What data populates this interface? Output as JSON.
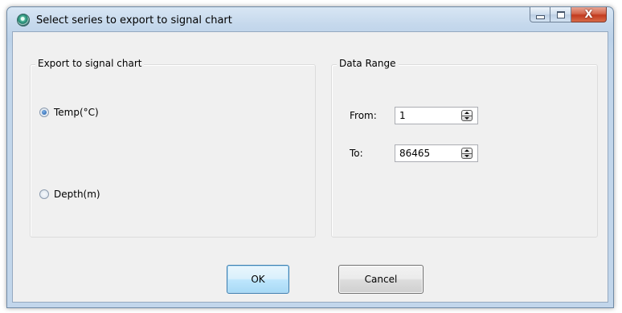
{
  "window": {
    "title": "Select series to export to signal chart",
    "icon": "app-globe-icon",
    "caption_buttons": {
      "minimize_icon": "minimize-icon",
      "maximize_icon": "maximize-icon",
      "close_icon": "close-icon",
      "close_glyph": "X"
    }
  },
  "export_group": {
    "title": "Export to signal chart",
    "options": [
      {
        "label": "Temp(°C)",
        "selected": true
      },
      {
        "label": "Depth(m)",
        "selected": false
      }
    ]
  },
  "range_group": {
    "title": "Data Range",
    "from_label": "From:",
    "from_value": "1",
    "to_label": "To:",
    "to_value": "86465"
  },
  "buttons": {
    "ok_label": "OK",
    "cancel_label": "Cancel"
  },
  "colors": {
    "ok_button_accent": "#3c7fb1",
    "radio_selected": "#1b5aa6",
    "close_button": "#c23b1f"
  }
}
